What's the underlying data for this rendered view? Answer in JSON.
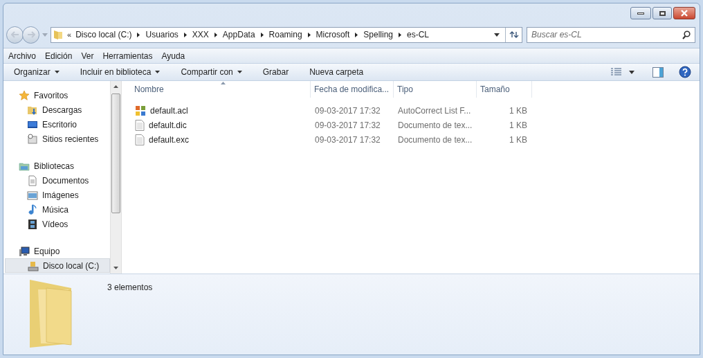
{
  "address_bar": {
    "overflow": "«",
    "crumbs": [
      "Disco local (C:)",
      "Usuarios",
      "XXX",
      "AppData",
      "Roaming",
      "Microsoft",
      "Spelling",
      "es-CL"
    ]
  },
  "search": {
    "placeholder": "Buscar es-CL"
  },
  "menu": [
    "Archivo",
    "Edición",
    "Ver",
    "Herramientas",
    "Ayuda"
  ],
  "toolbar": [
    {
      "label": "Organizar",
      "dropdown": true
    },
    {
      "label": "Incluir en biblioteca",
      "dropdown": true
    },
    {
      "label": "Compartir con",
      "dropdown": true
    },
    {
      "label": "Grabar",
      "dropdown": false
    },
    {
      "label": "Nueva carpeta",
      "dropdown": false
    }
  ],
  "sidebar": [
    {
      "label": "Favoritos",
      "selected": false,
      "children": [
        {
          "label": "Descargas",
          "selected": false
        },
        {
          "label": "Escritorio",
          "selected": false
        },
        {
          "label": "Sitios recientes",
          "selected": false
        }
      ]
    },
    {
      "label": "Bibliotecas",
      "selected": false,
      "children": [
        {
          "label": "Documentos",
          "selected": false
        },
        {
          "label": "Imágenes",
          "selected": false
        },
        {
          "label": "Música",
          "selected": false
        },
        {
          "label": "Vídeos",
          "selected": false
        }
      ]
    },
    {
      "label": "Equipo",
      "selected": false,
      "children": [
        {
          "label": "Disco local (C:)",
          "selected": true
        }
      ]
    }
  ],
  "columns": [
    {
      "label": "Nombre",
      "sorted": true
    },
    {
      "label": "Fecha de modifica...",
      "sorted": false
    },
    {
      "label": "Tipo",
      "sorted": false
    },
    {
      "label": "Tamaño",
      "sorted": false
    }
  ],
  "files": [
    {
      "kind": "autocorrect",
      "name": "default.acl",
      "date": "09-03-2017 17:32",
      "type": "AutoCorrect List F...",
      "size": "1 KB"
    },
    {
      "kind": "document",
      "name": "default.dic",
      "date": "09-03-2017 17:32",
      "type": "Documento de tex...",
      "size": "1 KB"
    },
    {
      "kind": "document",
      "name": "default.exc",
      "date": "09-03-2017 17:32",
      "type": "Documento de tex...",
      "size": "1 KB"
    }
  ],
  "status": {
    "count": "3 elementos"
  }
}
